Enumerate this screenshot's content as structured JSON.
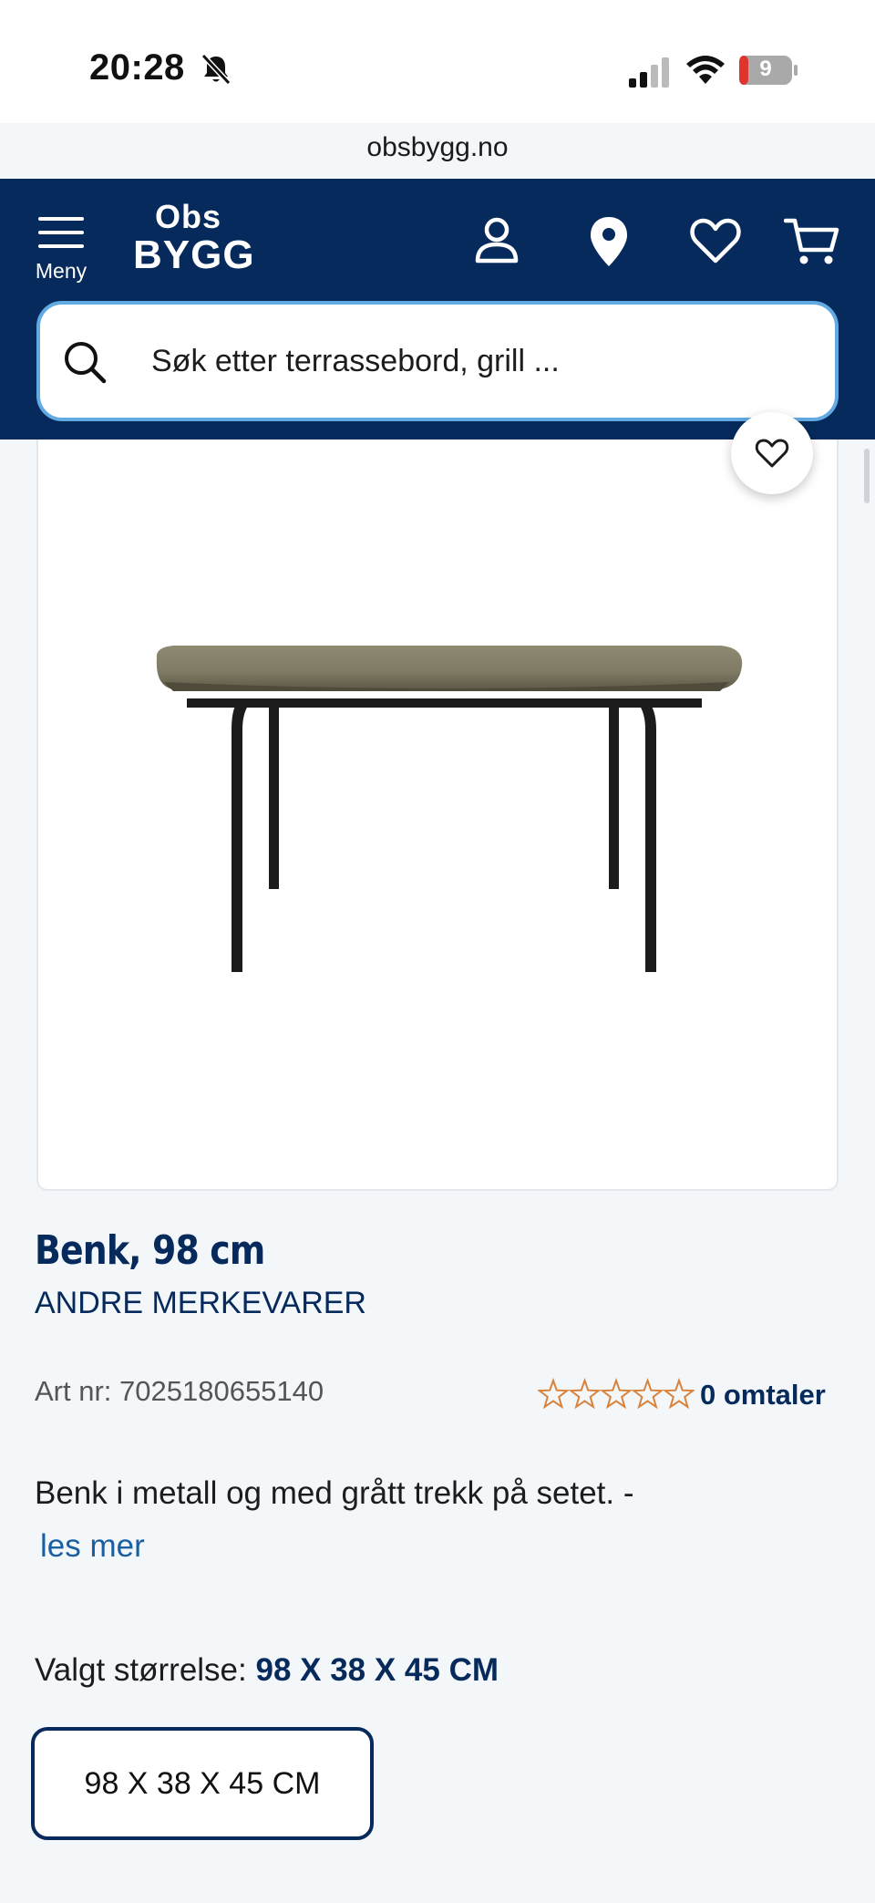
{
  "status_bar": {
    "time": "20:28",
    "battery": "9"
  },
  "browser": {
    "url": "obsbygg.no"
  },
  "header": {
    "menu_label": "Meny",
    "logo_top": "Obs",
    "logo_bottom": "BYGG",
    "search_placeholder": "Søk etter terrassebord, grill ..."
  },
  "product": {
    "title": "Benk, 98 cm",
    "brand": "ANDRE MERKEVARER",
    "art_nr": "Art nr: 7025180655140",
    "rating": 0,
    "reviews": "0 omtaler",
    "description": "Benk i metall og med grått trekk på setet. -",
    "read_more": "les mer",
    "size_prefix": "Valgt størrelse: ",
    "size_selected": "98 X 38 X 45 CM",
    "size_options": [
      "98 X 38 X 45 CM"
    ]
  },
  "colors": {
    "brand_navy": "#062a5c",
    "search_border": "#63a9e2",
    "star_outline": "#d9823b",
    "link": "#1a5fa0"
  }
}
